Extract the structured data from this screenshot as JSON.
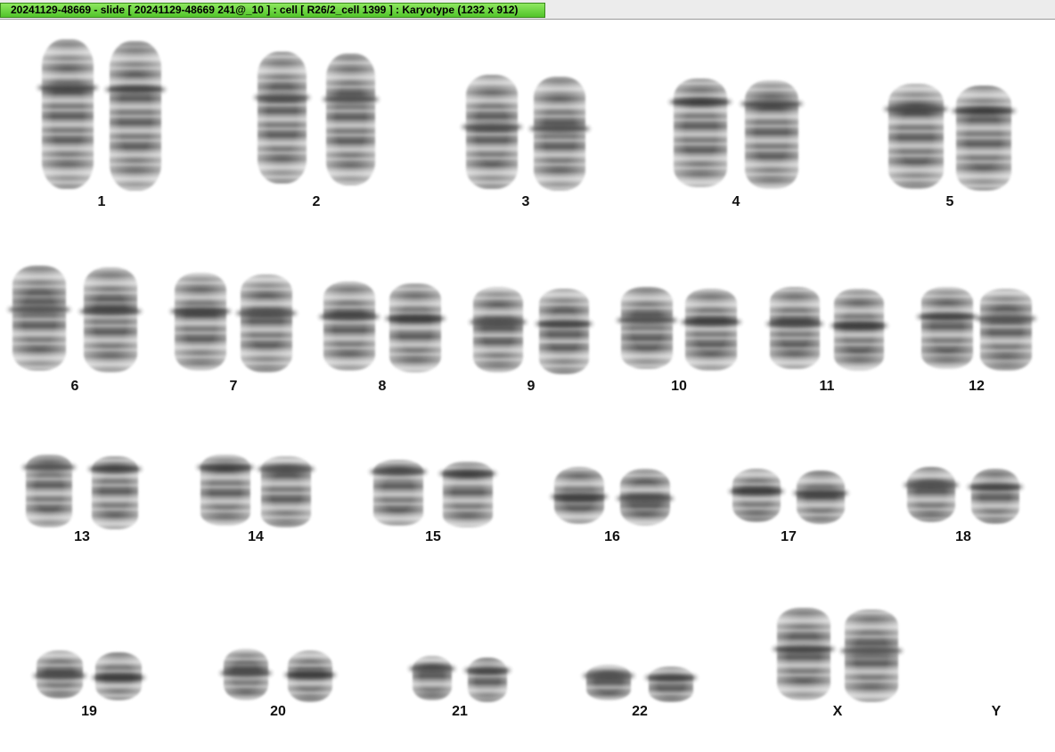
{
  "window": {
    "title": "20241129-48669 - slide [ 20241129-48669 241@_10 ] : cell [ R26/2_cell 1399 ] : Karyotype  (1232 x 912)"
  },
  "karyotype": {
    "chromosomes": [
      {
        "id": "1",
        "label": "1"
      },
      {
        "id": "2",
        "label": "2"
      },
      {
        "id": "3",
        "label": "3"
      },
      {
        "id": "4",
        "label": "4"
      },
      {
        "id": "5",
        "label": "5"
      },
      {
        "id": "6",
        "label": "6"
      },
      {
        "id": "7",
        "label": "7"
      },
      {
        "id": "8",
        "label": "8"
      },
      {
        "id": "9",
        "label": "9"
      },
      {
        "id": "10",
        "label": "10"
      },
      {
        "id": "11",
        "label": "11"
      },
      {
        "id": "12",
        "label": "12"
      },
      {
        "id": "13",
        "label": "13"
      },
      {
        "id": "14",
        "label": "14"
      },
      {
        "id": "15",
        "label": "15"
      },
      {
        "id": "16",
        "label": "16"
      },
      {
        "id": "17",
        "label": "17"
      },
      {
        "id": "18",
        "label": "18"
      },
      {
        "id": "19",
        "label": "19"
      },
      {
        "id": "20",
        "label": "20"
      },
      {
        "id": "21",
        "label": "21"
      },
      {
        "id": "22",
        "label": "22"
      },
      {
        "id": "X",
        "label": "X"
      },
      {
        "id": "Y",
        "label": "Y"
      }
    ]
  },
  "colors": {
    "title_tab": "#5ccb30",
    "background": "#ffffff"
  }
}
